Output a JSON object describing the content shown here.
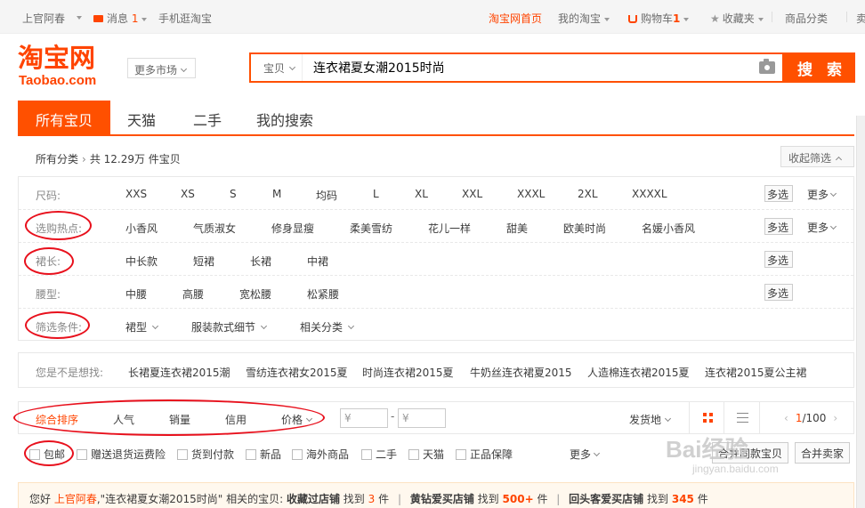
{
  "site_nav": {
    "username": "上官阿春",
    "messages_label": "消息",
    "messages_count": "1",
    "mobile": "手机逛淘宝",
    "home": "淘宝网首页",
    "my_taobao": "我的淘宝",
    "cart_label": "购物车",
    "cart_count": "1",
    "favorites": "收藏夹",
    "categories": "商品分类",
    "seller_partial": "卖"
  },
  "header": {
    "logo_cn": "淘宝网",
    "logo_en": "Taobao.com",
    "more_market": "更多市场",
    "search_type": "宝贝",
    "search_query": "连衣裙夏女潮2015时尚",
    "search_button": "搜 索"
  },
  "tabs": [
    "所有宝贝",
    "天猫",
    "二手",
    "我的搜索"
  ],
  "breadcrumb": {
    "root": "所有分类",
    "summary": "共 12.29万 件宝贝",
    "collapse": "收起筛选"
  },
  "filters": [
    {
      "label": "尺码:",
      "values": [
        "XXS",
        "XS",
        "S",
        "M",
        "均码",
        "L",
        "XL",
        "XXL",
        "XXXL",
        "2XL",
        "XXXXL"
      ],
      "multi": "多选",
      "more": "更多"
    },
    {
      "label": "选购热点:",
      "values": [
        "小香风",
        "气质淑女",
        "修身显瘦",
        "柔美雪纺",
        "花儿一样",
        "甜美",
        "欧美时尚",
        "名媛小香风"
      ],
      "multi": "多选",
      "more": "更多"
    },
    {
      "label": "裙长:",
      "values": [
        "中长款",
        "短裙",
        "长裙",
        "中裙"
      ],
      "multi": "多选"
    },
    {
      "label": "腰型:",
      "values": [
        "中腰",
        "高腰",
        "宽松腰",
        "松紧腰"
      ],
      "multi": "多选"
    },
    {
      "label": "筛选条件:",
      "values": [
        "裙型",
        "服装款式细节",
        "相关分类"
      ]
    }
  ],
  "suggestions": {
    "label": "您是不是想找:",
    "items": [
      "长裙夏连衣裙2015潮",
      "雪纺连衣裙女2015夏",
      "时尚连衣裙2015夏",
      "牛奶丝连衣裙夏2015",
      "人造棉连衣裙2015夏",
      "连衣裙2015夏公主裙"
    ]
  },
  "sortbar": {
    "items": [
      "综合排序",
      "人气",
      "销量",
      "信用",
      "价格"
    ],
    "price_from": "¥",
    "price_to": "¥",
    "price_dash": "-",
    "ship_from": "发货地",
    "page_current": "1",
    "page_total": "/100"
  },
  "checkboxes": {
    "items": [
      "包邮",
      "赠送退货运费险",
      "货到付款",
      "新品",
      "海外商品",
      "二手",
      "天猫",
      "正品保障"
    ],
    "more": "更多",
    "merge_same": "合并同款宝贝",
    "merge_seller": "合并卖家"
  },
  "notice": {
    "greet": "您好",
    "user": "上官阿春",
    "query_part": ",\"连衣裙夏女潮2015时尚\" 相关的宝贝:",
    "g1_label": "收藏过店铺",
    "g1_mid": "找到",
    "g1_count": "3",
    "g1_unit": "件",
    "sep": "|",
    "g2_label": "黄钻爱买店铺",
    "g2_mid": "找到",
    "g2_count": "500+",
    "g2_unit": "件",
    "g3_label": "回头客爱买店铺",
    "g3_mid": "找到",
    "g3_count": "345",
    "g3_unit": "件"
  },
  "watermark": {
    "main": "Bai经验",
    "sub": "jingyan.baidu.com"
  },
  "colors": {
    "brand_orange": "#ff5000",
    "accent_red": "#f40",
    "annotation_red": "#e8101c"
  }
}
